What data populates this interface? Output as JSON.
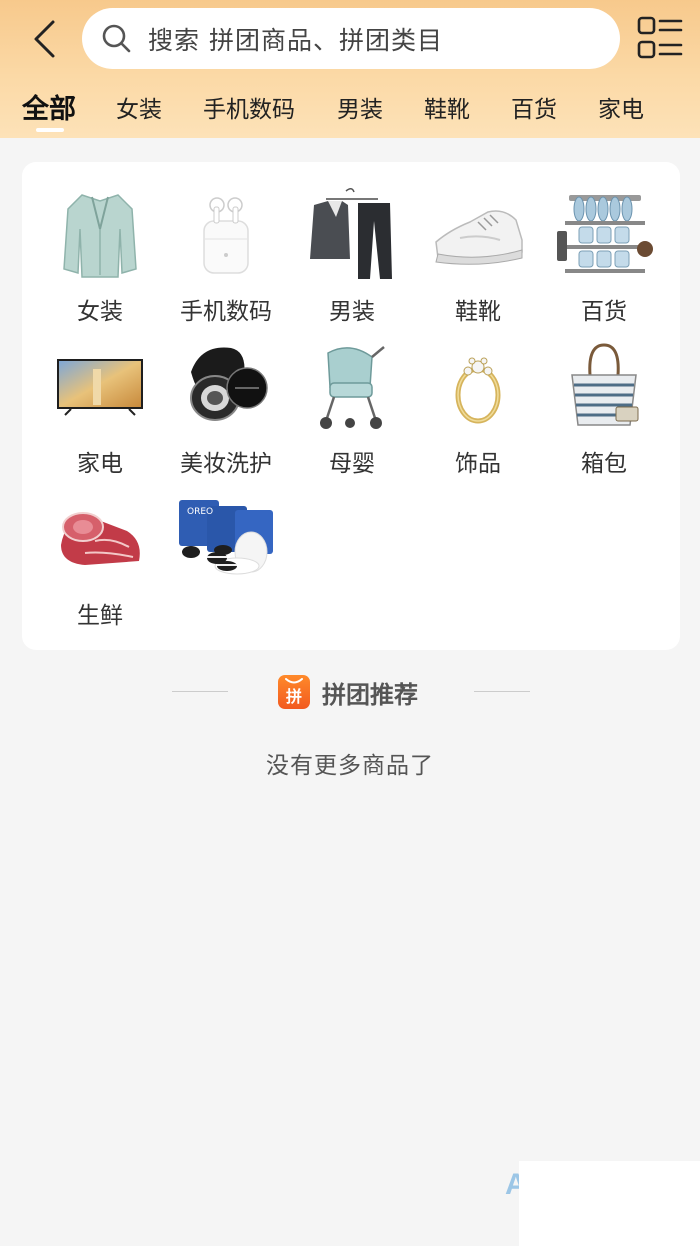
{
  "header": {
    "search": {
      "placeholder": "搜索 拼团商品、拼团类目"
    },
    "tabs": [
      {
        "label": "全部",
        "active": true
      },
      {
        "label": "女装"
      },
      {
        "label": "手机数码"
      },
      {
        "label": "男装"
      },
      {
        "label": "鞋靴"
      },
      {
        "label": "百货"
      },
      {
        "label": "家电"
      }
    ]
  },
  "categories": [
    {
      "label": "女装",
      "icon": "blazer-image"
    },
    {
      "label": "手机数码",
      "icon": "earbuds-image"
    },
    {
      "label": "男装",
      "icon": "suit-image"
    },
    {
      "label": "鞋靴",
      "icon": "sneaker-image"
    },
    {
      "label": "百货",
      "icon": "dish-rack-image"
    },
    {
      "label": "家电",
      "icon": "tv-image"
    },
    {
      "label": "美妆洗护",
      "icon": "cosmetics-image"
    },
    {
      "label": "母婴",
      "icon": "stroller-image"
    },
    {
      "label": "饰品",
      "icon": "ring-image"
    },
    {
      "label": "箱包",
      "icon": "handbag-image"
    },
    {
      "label": "生鲜",
      "icon": "meat-image"
    },
    {
      "label": "",
      "icon": "cookies-image"
    }
  ],
  "recommend": {
    "title": "拼团推荐",
    "logo_char": "拼",
    "empty_text": "没有更多商品了"
  },
  "colors": {
    "header_top": "#f7c98c",
    "header_bottom": "#fde2b8",
    "page_bg": "#f5f5f5",
    "brand_orange": "#f25a20"
  },
  "corner_glyph": "A"
}
